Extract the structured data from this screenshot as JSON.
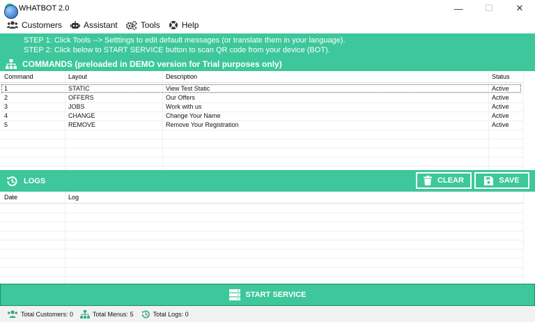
{
  "window": {
    "title": "WHATBOT 2.0",
    "icon": "whatbot-app-icon",
    "controls": {
      "minimize": "—",
      "maximize": "☐",
      "close": "✕"
    }
  },
  "menu": {
    "items": [
      {
        "label": "Customers",
        "icon": "users-icon"
      },
      {
        "label": "Assistant",
        "icon": "robot-icon"
      },
      {
        "label": "Tools",
        "icon": "gears-icon"
      },
      {
        "label": "Help",
        "icon": "lifebuoy-icon"
      }
    ]
  },
  "info": {
    "step1": "STEP 1: Click Tools --> Setttings to edit  default messages (or translate them in your language).",
    "step2": "STEP 2: Click below to START SERVICE button to scan QR code from your device (BOT)."
  },
  "commands": {
    "title": "COMMANDS (preloaded in DEMO version for Trial purposes only)",
    "columns": [
      "Command",
      "Layout",
      "Description",
      "Status"
    ],
    "rows": [
      {
        "command": "1",
        "layout": "STATIC",
        "description": "View Test Static",
        "status": "Active"
      },
      {
        "command": "2",
        "layout": "OFFERS",
        "description": "Our Offers",
        "status": "Active"
      },
      {
        "command": "3",
        "layout": "JOBS",
        "description": "Work with us",
        "status": "Active"
      },
      {
        "command": "4",
        "layout": "CHANGE",
        "description": "Change Your Name",
        "status": "Active"
      },
      {
        "command": "5",
        "layout": "REMOVE",
        "description": "Remove Your Registration",
        "status": "Active"
      }
    ]
  },
  "logs": {
    "title": "LOGS",
    "columns": [
      "Date",
      "Log"
    ],
    "clear_label": "CLEAR",
    "save_label": "SAVE"
  },
  "start_label": "START SERVICE",
  "status": {
    "customers": "Total Customers: 0",
    "menus": "Total Menus: 5",
    "logs": "Total Logs: 0"
  },
  "colors": {
    "accent": "#3dc79a",
    "accent_dark": "#1e8f6a"
  }
}
